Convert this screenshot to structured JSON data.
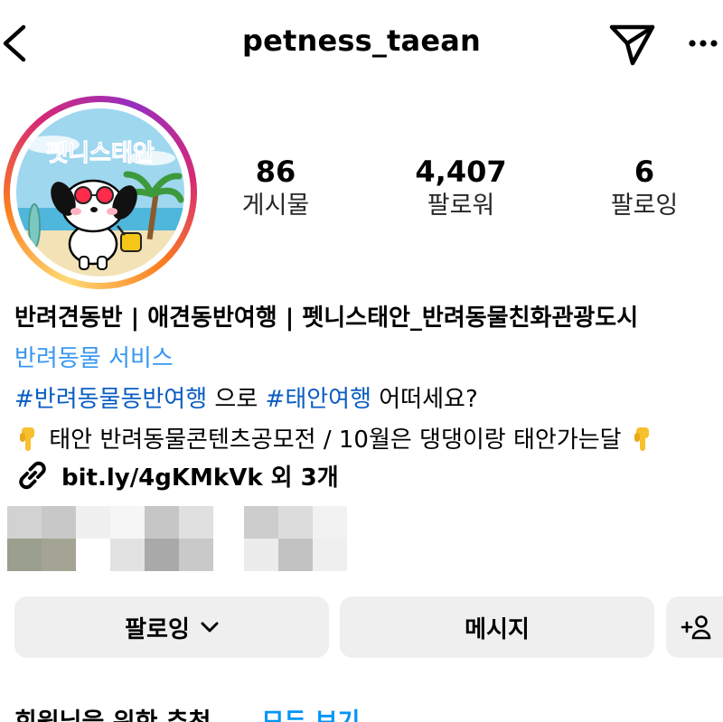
{
  "header": {
    "username": "petness_taean",
    "back_icon": "chevron-left-icon",
    "send_icon": "paper-plane-icon",
    "more_icon": "more-horizontal-icon"
  },
  "avatar": {
    "logo_text": "펫니스태안",
    "ring_colors": [
      "#feda75",
      "#fa7e1e",
      "#d62976",
      "#962fbf"
    ]
  },
  "stats": {
    "posts": {
      "value": "86",
      "label": "게시물"
    },
    "followers": {
      "value": "4,407",
      "label": "팔로워"
    },
    "following": {
      "value": "6",
      "label": "팔로잉"
    }
  },
  "bio": {
    "name": "반려견동반 | 애견동반여행 | 펫니스태안_반려동물친화관광도시",
    "category": "반려동물 서비스",
    "hashtag1": "#반려동물동반여행",
    "text_mid": " 으로 ",
    "hashtag2": "#태안여행",
    "text_end": " 어떠세요?",
    "line4": " 태안 반려동물콘텐츠공모전 / 10월은 댕댕이랑 태안가는달 ",
    "pointing_icon": "pointing-down-emoji-icon"
  },
  "link": {
    "icon": "link-icon",
    "text": "bit.ly/4gKMkVk 외 3개"
  },
  "buttons": {
    "follow_label": "팔로잉",
    "message_label": "메시지",
    "add_user_icon": "add-person-icon"
  },
  "suggestions": {
    "title": "회원님을 위한 추천",
    "see_all": "모두 보기"
  },
  "colors": {
    "accent": "#0095f6",
    "hashtag": "#0a5dc2",
    "category": "#3897f0",
    "button_bg": "#efefef"
  }
}
